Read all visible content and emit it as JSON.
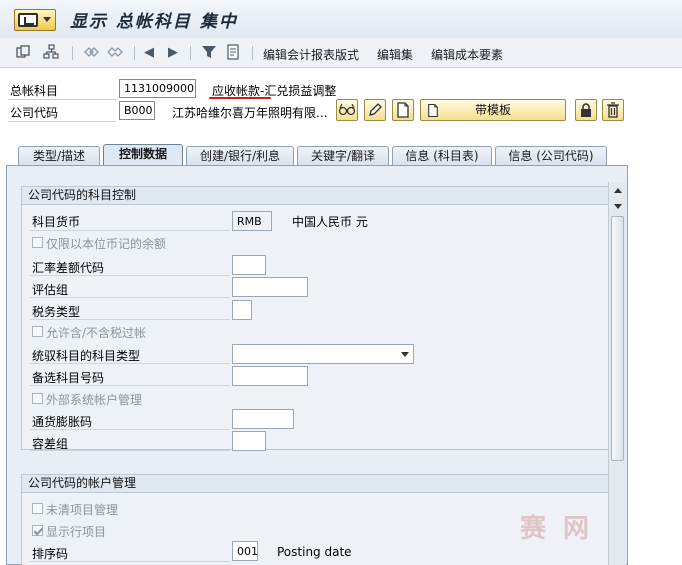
{
  "title": {
    "text": "显示 总帐科目 集中"
  },
  "toolbar": {
    "icons": [
      "copy-icon",
      "hierarchy-icon",
      "link-icon",
      "unlink-icon",
      "previous-icon",
      "next-icon",
      "filter-icon",
      "document-icon"
    ],
    "prev_glyph": "◀",
    "next_glyph": "▶",
    "item1": "编辑会计报表版式",
    "item2": "编辑集",
    "item3": "编辑成本要素"
  },
  "header": {
    "gl_account_label": "总帐科目",
    "gl_account_value": "1131009000",
    "gl_account_desc": "应收帐款-汇兑损益调整",
    "company_code_label": "公司代码",
    "company_code_value": "B000",
    "company_code_desc": "江苏哈维尔喜万年照明有限...",
    "template_button": "带模板"
  },
  "tabs": [
    {
      "label": "类型/描述"
    },
    {
      "label": "控制数据"
    },
    {
      "label": "创建/银行/利息"
    },
    {
      "label": "关键字/翻译"
    },
    {
      "label": "信息 (科目表)"
    },
    {
      "label": "信息 (公司代码)"
    }
  ],
  "section1": {
    "title": "公司代码的科目控制",
    "currency_label": "科目货币",
    "currency_value": "RMB",
    "currency_desc": "中国人民币 元",
    "local_only_label": "仅限以本位币记的余额",
    "exchange_label": "汇率差额代码",
    "valuation_label": "评估组",
    "tax_label": "税务类型",
    "tax_allowed_label": "允许含/不含税过帐",
    "recon_label": "统驭科目的科目类型",
    "alt_label": "备选科目号码",
    "external_label": "外部系统帐户管理",
    "inflation_label": "通货膨胀码",
    "tolerance_label": "容差组"
  },
  "section2": {
    "title": "公司代码的帐户管理",
    "open_item_label": "未清项目管理",
    "line_item_label": "显示行项目",
    "sort_label": "排序码",
    "sort_value": "001",
    "sort_desc": "Posting date"
  },
  "watermark": "赛 网"
}
